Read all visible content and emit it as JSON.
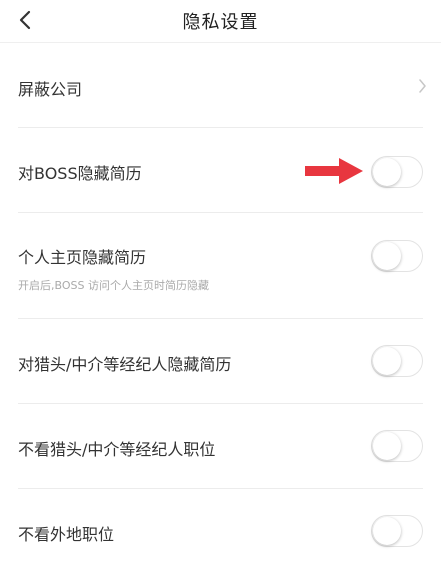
{
  "header": {
    "title": "隐私设置",
    "back_icon": "chevron-left-icon"
  },
  "settings": [
    {
      "label": "屏蔽公司",
      "control": "chevron-right-icon"
    },
    {
      "label": "对BOSS隐藏简历",
      "control": "toggle",
      "enabled": false
    },
    {
      "label": "个人主页隐藏简历",
      "sublabel": "开启后,BOSS 访问个人主页时简历隐藏",
      "control": "toggle",
      "enabled": false
    },
    {
      "label": "对猎头/中介等经纪人隐藏简历",
      "control": "toggle",
      "enabled": false
    },
    {
      "label": "不看猎头/中介等经纪人职位",
      "control": "toggle",
      "enabled": false
    },
    {
      "label": "不看外地职位",
      "control": "toggle",
      "enabled": false
    }
  ],
  "annotation": {
    "icon": "red-arrow-right-icon",
    "color": "#e8363f"
  }
}
